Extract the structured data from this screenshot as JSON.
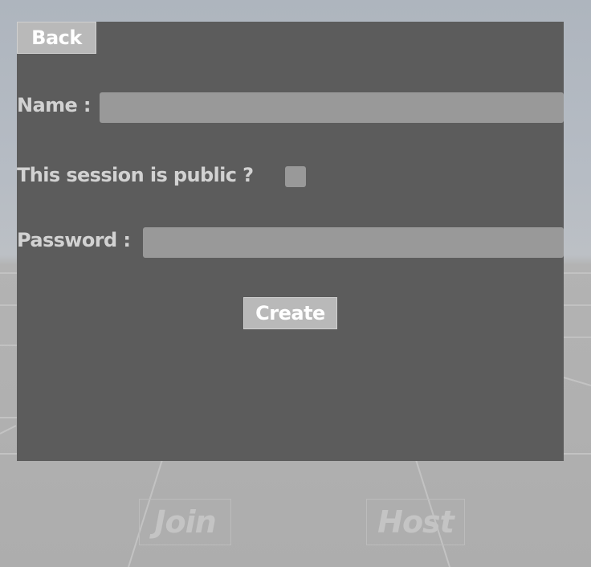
{
  "panel": {
    "back_label": "Back",
    "name_label": "Name :",
    "name_value": "",
    "public_label": "This session is public ?",
    "public_checked": false,
    "password_label": "Password :",
    "password_value": "",
    "create_label": "Create"
  },
  "background": {
    "join_label": "Join",
    "host_label": "Host"
  },
  "colors": {
    "panel_bg": "#5c5c5c",
    "field_bg": "#999999",
    "button_bg": "#b9b9b9",
    "label_text": "#d2d2d2"
  }
}
